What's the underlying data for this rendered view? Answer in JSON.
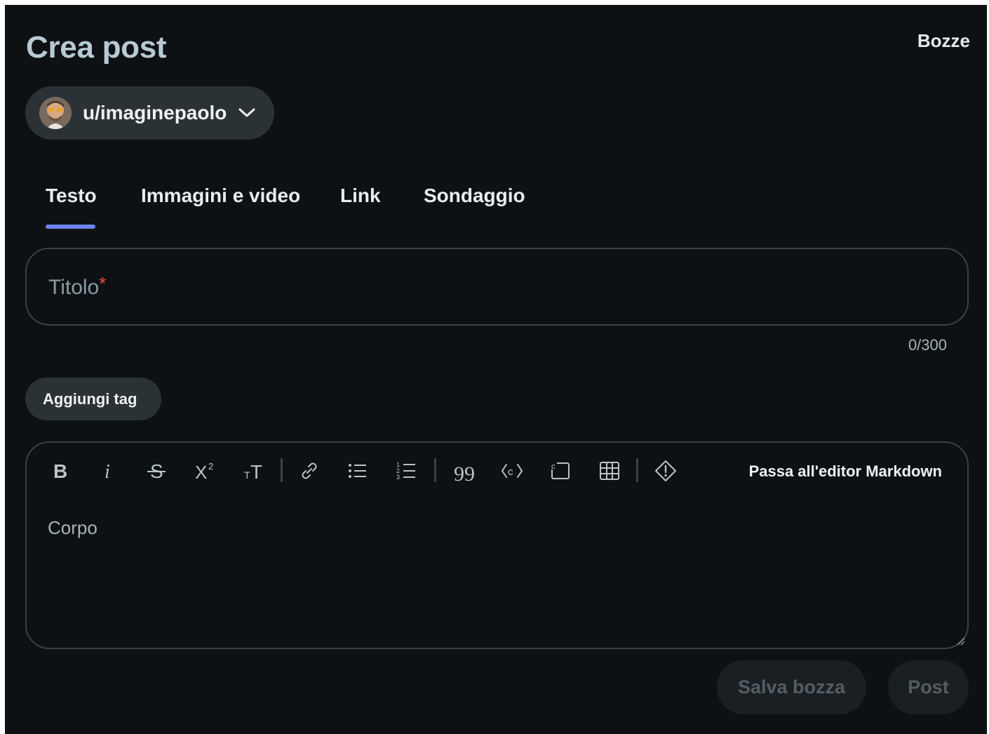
{
  "header": {
    "title": "Crea post",
    "drafts_label": "Bozze"
  },
  "community_selector": {
    "username": "u/imaginepaolo",
    "avatar_icon": "user-avatar-icon",
    "chevron_icon": "chevron-down-icon"
  },
  "tabs": [
    {
      "label": "Testo",
      "active": true
    },
    {
      "label": "Immagini e video",
      "active": false
    },
    {
      "label": "Link",
      "active": false
    },
    {
      "label": "Sondaggio",
      "active": false
    }
  ],
  "title_field": {
    "placeholder": "Titolo",
    "required_mark": "*",
    "counter": "0/300"
  },
  "tags": {
    "button_label": "Aggiungi tag"
  },
  "editor": {
    "toolbar_icons": [
      "bold-icon",
      "italic-icon",
      "strikethrough-icon",
      "superscript-icon",
      "heading-icon",
      "link-icon",
      "bulleted-list-icon",
      "numbered-list-icon",
      "quote-icon",
      "code-icon",
      "code-block-icon",
      "table-icon",
      "spoiler-icon"
    ],
    "markdown_switch_label": "Passa all'editor Markdown",
    "body_placeholder": "Corpo"
  },
  "actions": {
    "save_draft_label": "Salva bozza",
    "post_label": "Post"
  },
  "colors": {
    "background": "#0e1113",
    "surface": "#2a3236",
    "border": "#3a4246",
    "accent": "#6a84f0",
    "required": "#e0523b",
    "disabled_text": "#525d63"
  }
}
